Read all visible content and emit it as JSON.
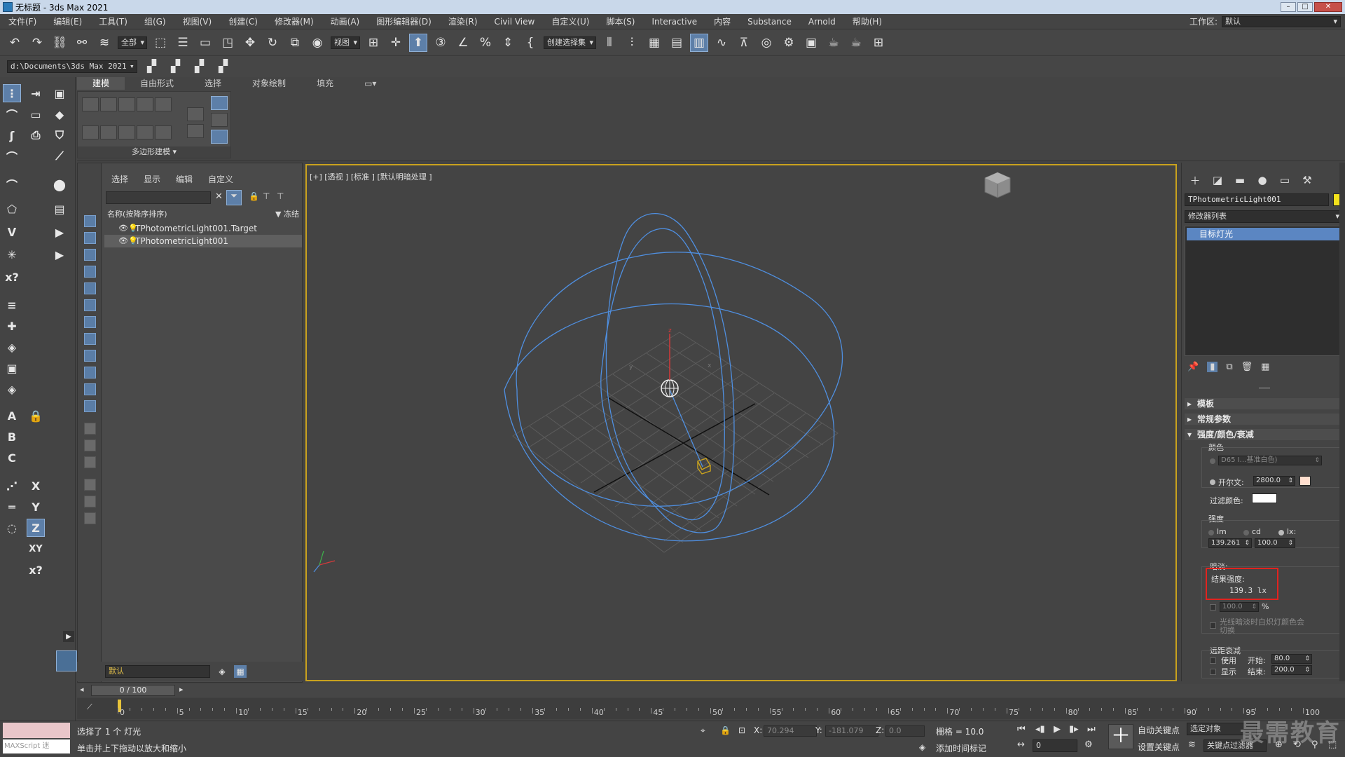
{
  "window": {
    "title": "无标题 - 3ds Max 2021"
  },
  "menu": {
    "items": [
      "文件(F)",
      "编辑(E)",
      "工具(T)",
      "组(G)",
      "视图(V)",
      "创建(C)",
      "修改器(M)",
      "动画(A)",
      "图形编辑器(D)",
      "渲染(R)",
      "Civil View",
      "自定义(U)",
      "脚本(S)",
      "Interactive",
      "内容",
      "Substance",
      "Arnold",
      "帮助(H)"
    ],
    "workspace_label": "工作区:",
    "workspace_value": "默认"
  },
  "toolbar": {
    "filter": "全部",
    "refcoord": "视图",
    "selset": "创建选择集"
  },
  "pathbar": {
    "path": "d:\\Documents\\3ds Max 2021"
  },
  "ribbon": {
    "tabs": [
      "建模",
      "自由形式",
      "选择",
      "对象绘制",
      "填充"
    ],
    "panel_caption": "多边形建模"
  },
  "explorer": {
    "menu": [
      "选择",
      "显示",
      "编辑",
      "自定义"
    ],
    "col_name": "名称(按降序排序)",
    "col_freeze": "冻结",
    "rows": [
      "TPhotometricLight001.Target",
      "TPhotometricLight001"
    ],
    "layer": "默认"
  },
  "viewport": {
    "label": "[+] [透视 ] [标准 ] [默认明暗处理 ]",
    "colors": {
      "wire": "#4f8fe0",
      "frame": "#c9a21e",
      "grid": "#5a5a5a"
    }
  },
  "command_panel": {
    "object_name": "TPhotometricLight001",
    "object_color": "#f4e21c",
    "modifier_list": "修改器列表",
    "stack_item": "目标灯光",
    "rollouts": {
      "template": "模板",
      "general": "常规参数",
      "intensity": "强度/颜色/衰减"
    },
    "color_group": "颜色",
    "color_preset": "D65 I…基准白色)",
    "kelvin_label": "开尔文:",
    "kelvin_value": "2800.0",
    "filter_color_label": "过滤颜色:",
    "intensity_group": "强度",
    "unit_lm": "lm",
    "unit_cd": "cd",
    "unit_lx": "lx:",
    "intensity_value": "139.261",
    "distance_value": "100.0",
    "dimming_group": "暗淡:",
    "result_label": "结果强度:",
    "result_value": "139.3 lx",
    "percent_value": "100.0",
    "percent_unit": "%",
    "incandescent": "光线暗淡时白炽灯颜色会切换",
    "far_atten": "远距衰减",
    "use_label": "使用",
    "show_label": "显示",
    "start_label": "开始:",
    "start_value": "80.0",
    "end_label": "结束:",
    "end_value": "200.0"
  },
  "timeline": {
    "frame": "0 / 100",
    "ticks": [
      "0",
      "5",
      "10",
      "15",
      "20",
      "25",
      "30",
      "35",
      "40",
      "45",
      "50",
      "55",
      "60",
      "65",
      "70",
      "75",
      "80",
      "85",
      "90",
      "95",
      "100"
    ]
  },
  "status": {
    "maxscript": "MAXScript 迷",
    "selected": "选择了 1 个 灯光",
    "hint": "单击并上下拖动以放大和缩小",
    "x_label": "X:",
    "x_value": "70.294",
    "y_label": "Y:",
    "y_value": "-181.079",
    "z_label": "Z:",
    "z_value": "0.0",
    "grid": "栅格 = 10.0",
    "add_time_tag": "添加时间标记",
    "auto_key": "自动关键点",
    "set_key": "设置关键点",
    "selected_obj": "选定对象",
    "key_filter": "关键点过滤器",
    "frame_field": "0",
    "watermark": "最需教育"
  }
}
